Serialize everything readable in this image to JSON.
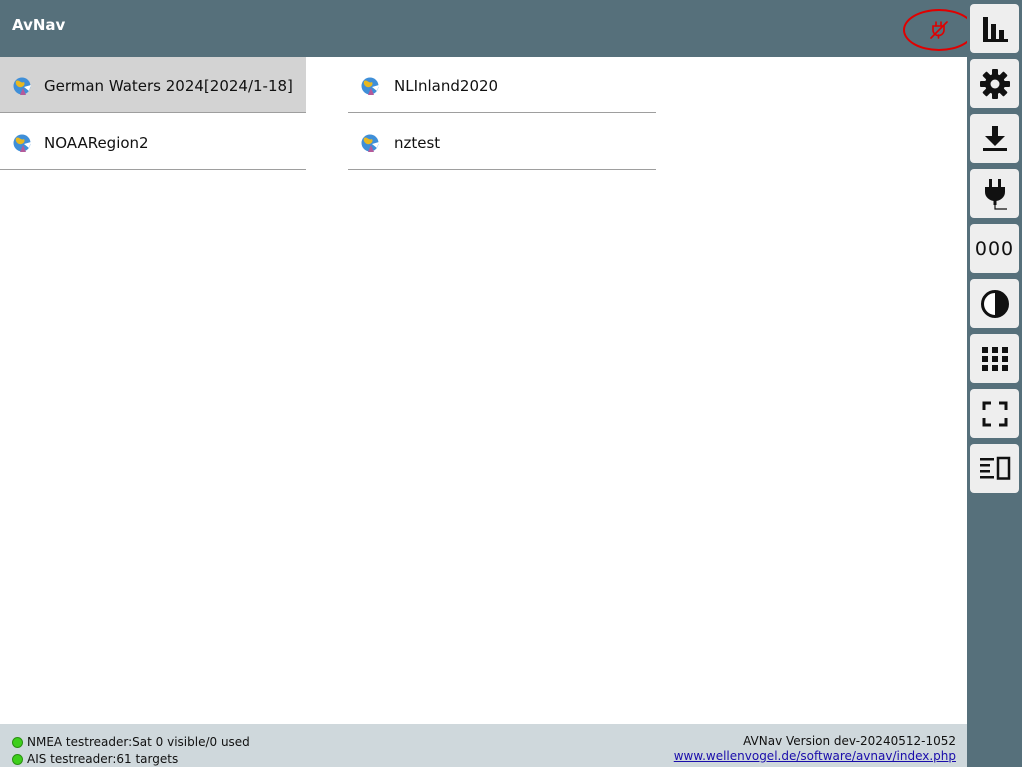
{
  "header": {
    "title": "AvNav",
    "connection_icon": "disconnected-plug-icon"
  },
  "charts": [
    {
      "name": "German Waters 2024[2024/1-18]",
      "selected": true
    },
    {
      "name": "NLInland2020",
      "selected": false
    },
    {
      "name": "NOAARegion2",
      "selected": false
    },
    {
      "name": "nztest",
      "selected": false
    }
  ],
  "sidebar": {
    "buttons": [
      {
        "icon": "bar-chart-icon"
      },
      {
        "icon": "gear-icon"
      },
      {
        "icon": "download-icon"
      },
      {
        "icon": "plug-icon"
      },
      {
        "icon": "counter-icon",
        "label": "000"
      },
      {
        "icon": "contrast-icon"
      },
      {
        "icon": "grid-icon"
      },
      {
        "icon": "fullscreen-icon"
      },
      {
        "icon": "split-view-icon"
      }
    ]
  },
  "footer": {
    "nmea_status": "NMEA testreader:Sat 0 visible/0 used",
    "ais_status": "AIS testreader:61 targets",
    "version": "AVNav Version dev-20240512-1052",
    "link": "www.wellenvogel.de/software/avnav/index.php"
  },
  "colors": {
    "header": "#56707b",
    "footer": "#cfd8dc",
    "selected": "#d3d3d3",
    "status_ok": "#3ecf1c",
    "alert": "#e00000"
  }
}
